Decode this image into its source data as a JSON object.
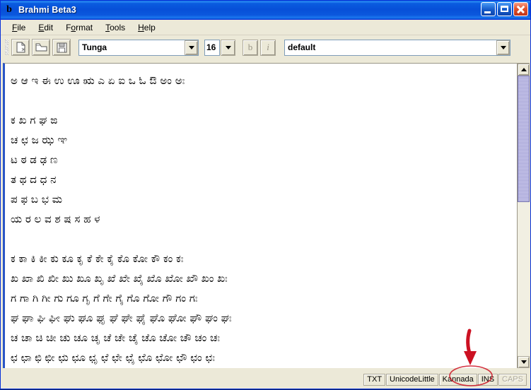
{
  "window": {
    "title": "Brahmi Beta3",
    "icon": "app-logo-b",
    "controls": {
      "minimize": "minimize-icon",
      "maximize": "maximize-icon",
      "close": "close-icon"
    }
  },
  "menubar": {
    "items": [
      {
        "label": "File",
        "accel": "F"
      },
      {
        "label": "Edit",
        "accel": "E"
      },
      {
        "label": "Format",
        "accel": "o"
      },
      {
        "label": "Tools",
        "accel": "T"
      },
      {
        "label": "Help",
        "accel": "H"
      }
    ]
  },
  "toolbar": {
    "new_icon": "new-document-icon",
    "open_icon": "open-folder-icon",
    "save_icon": "save-floppy-icon",
    "font_name": "Tunga",
    "font_size": "16",
    "bold_label": "b",
    "italic_label": "i",
    "style_name": "default"
  },
  "editor": {
    "lines": [
      "ಅ ಆ ಇ ಈ ಉ ಊ ಋ ಎ ಏ ಐ ಒ ಓ ಔ ಅಂ ಅಃ",
      "",
      "ಕ ಖ ಗ ಘ ಙ",
      "ಚ ಛ ಜ ಝ ಞ",
      "ಟ ಠ ಡ ಢ ಣ",
      "ತ ಥ ದ ಧ ನ",
      "ಪ ಫ ಬ ಭ ಮ",
      "ಯ ರ ಲ ವ ಶ ಷ ಸ ಹ ಳ",
      "",
      "ಕ ಕಾ ಕಿ ಕೀ ಕು ಕೂ ಕೃ ಕೆ ಕೇ ಕೈ ಕೊ ಕೋ ಕೌ ಕಂ ಕಃ",
      "ಖ ಖಾ ಖಿ ಖೀ ಖು ಖೂ ಖೃ ಖೆ ಖೇ ಖೈ ಖೊ ಖೋ ಖೌ ಖಂ ಖಃ",
      "ಗ ಗಾ ಗಿ ಗೀ ಗು ಗೂ ಗೃ ಗೆ ಗೇ ಗೈ ಗೊ ಗೋ ಗೌ ಗಂ ಗಃ",
      "ಘ ಘಾ ಘಿ ಘೀ ಘು ಘೂ ಘೃ ಘೆ ಘೇ ಘೈ ಘೊ ಘೋ ಘೌ ಘಂ ಘಃ",
      "ಚ ಚಾ ಚಿ ಚೀ ಚು ಚೂ ಚೃ ಚೆ ಚೇ ಚೈ ಚೊ ಚೋ ಚೌ ಚಂ ಚಃ",
      "ಛ ಛಾ ಛಿ ಛೀ ಛು ಛೂ ಛೃ ಛೆ ಛೇ ಛೈ ಛೊ ಛೋ ಛೌ ಛಂ ಛಃ"
    ]
  },
  "scrollbar": {
    "up_icon": "scroll-up-arrow-icon",
    "down_icon": "scroll-down-arrow-icon",
    "thumb_position_percent": 0,
    "thumb_size_percent": 45
  },
  "statusbar": {
    "cells": [
      {
        "label": "TXT",
        "enabled": true,
        "highlighted": false
      },
      {
        "label": "UnicodeLittle",
        "enabled": true,
        "highlighted": false
      },
      {
        "label": "Kannada",
        "enabled": true,
        "highlighted": true
      },
      {
        "label": "INS",
        "enabled": true,
        "highlighted": false
      },
      {
        "label": "CAPS",
        "enabled": false,
        "highlighted": false
      }
    ]
  },
  "annotation": {
    "color": "#cc1122",
    "ellipse_target": "Kannada",
    "arrow": "down-arrow-annotation"
  },
  "colors": {
    "title_bar": "#0a53d6",
    "face": "#ece9d8",
    "editor_bg": "#ffffff",
    "scroll_thumb": "#b7b5e0",
    "annotation": "#cc1122"
  }
}
